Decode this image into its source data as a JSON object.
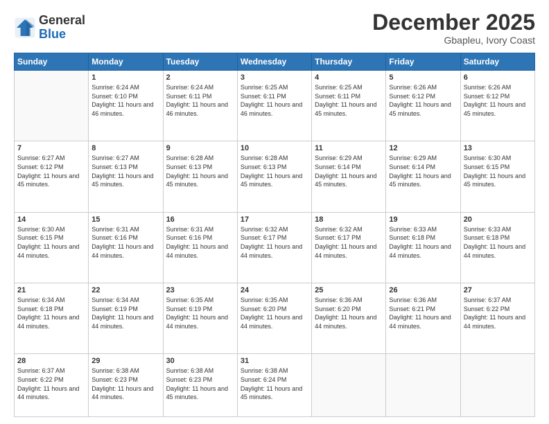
{
  "header": {
    "logo_line1": "General",
    "logo_line2": "Blue",
    "month": "December 2025",
    "location": "Gbapleu, Ivory Coast"
  },
  "weekdays": [
    "Sunday",
    "Monday",
    "Tuesday",
    "Wednesday",
    "Thursday",
    "Friday",
    "Saturday"
  ],
  "weeks": [
    [
      {
        "day": "",
        "empty": true
      },
      {
        "day": "1",
        "sunrise": "6:24 AM",
        "sunset": "6:10 PM",
        "daylight": "11 hours and 46 minutes."
      },
      {
        "day": "2",
        "sunrise": "6:24 AM",
        "sunset": "6:11 PM",
        "daylight": "11 hours and 46 minutes."
      },
      {
        "day": "3",
        "sunrise": "6:25 AM",
        "sunset": "6:11 PM",
        "daylight": "11 hours and 46 minutes."
      },
      {
        "day": "4",
        "sunrise": "6:25 AM",
        "sunset": "6:11 PM",
        "daylight": "11 hours and 45 minutes."
      },
      {
        "day": "5",
        "sunrise": "6:26 AM",
        "sunset": "6:12 PM",
        "daylight": "11 hours and 45 minutes."
      },
      {
        "day": "6",
        "sunrise": "6:26 AM",
        "sunset": "6:12 PM",
        "daylight": "11 hours and 45 minutes."
      }
    ],
    [
      {
        "day": "7",
        "sunrise": "6:27 AM",
        "sunset": "6:12 PM",
        "daylight": "11 hours and 45 minutes."
      },
      {
        "day": "8",
        "sunrise": "6:27 AM",
        "sunset": "6:13 PM",
        "daylight": "11 hours and 45 minutes."
      },
      {
        "day": "9",
        "sunrise": "6:28 AM",
        "sunset": "6:13 PM",
        "daylight": "11 hours and 45 minutes."
      },
      {
        "day": "10",
        "sunrise": "6:28 AM",
        "sunset": "6:13 PM",
        "daylight": "11 hours and 45 minutes."
      },
      {
        "day": "11",
        "sunrise": "6:29 AM",
        "sunset": "6:14 PM",
        "daylight": "11 hours and 45 minutes."
      },
      {
        "day": "12",
        "sunrise": "6:29 AM",
        "sunset": "6:14 PM",
        "daylight": "11 hours and 45 minutes."
      },
      {
        "day": "13",
        "sunrise": "6:30 AM",
        "sunset": "6:15 PM",
        "daylight": "11 hours and 45 minutes."
      }
    ],
    [
      {
        "day": "14",
        "sunrise": "6:30 AM",
        "sunset": "6:15 PM",
        "daylight": "11 hours and 44 minutes."
      },
      {
        "day": "15",
        "sunrise": "6:31 AM",
        "sunset": "6:16 PM",
        "daylight": "11 hours and 44 minutes."
      },
      {
        "day": "16",
        "sunrise": "6:31 AM",
        "sunset": "6:16 PM",
        "daylight": "11 hours and 44 minutes."
      },
      {
        "day": "17",
        "sunrise": "6:32 AM",
        "sunset": "6:17 PM",
        "daylight": "11 hours and 44 minutes."
      },
      {
        "day": "18",
        "sunrise": "6:32 AM",
        "sunset": "6:17 PM",
        "daylight": "11 hours and 44 minutes."
      },
      {
        "day": "19",
        "sunrise": "6:33 AM",
        "sunset": "6:18 PM",
        "daylight": "11 hours and 44 minutes."
      },
      {
        "day": "20",
        "sunrise": "6:33 AM",
        "sunset": "6:18 PM",
        "daylight": "11 hours and 44 minutes."
      }
    ],
    [
      {
        "day": "21",
        "sunrise": "6:34 AM",
        "sunset": "6:18 PM",
        "daylight": "11 hours and 44 minutes."
      },
      {
        "day": "22",
        "sunrise": "6:34 AM",
        "sunset": "6:19 PM",
        "daylight": "11 hours and 44 minutes."
      },
      {
        "day": "23",
        "sunrise": "6:35 AM",
        "sunset": "6:19 PM",
        "daylight": "11 hours and 44 minutes."
      },
      {
        "day": "24",
        "sunrise": "6:35 AM",
        "sunset": "6:20 PM",
        "daylight": "11 hours and 44 minutes."
      },
      {
        "day": "25",
        "sunrise": "6:36 AM",
        "sunset": "6:20 PM",
        "daylight": "11 hours and 44 minutes."
      },
      {
        "day": "26",
        "sunrise": "6:36 AM",
        "sunset": "6:21 PM",
        "daylight": "11 hours and 44 minutes."
      },
      {
        "day": "27",
        "sunrise": "6:37 AM",
        "sunset": "6:22 PM",
        "daylight": "11 hours and 44 minutes."
      }
    ],
    [
      {
        "day": "28",
        "sunrise": "6:37 AM",
        "sunset": "6:22 PM",
        "daylight": "11 hours and 44 minutes."
      },
      {
        "day": "29",
        "sunrise": "6:38 AM",
        "sunset": "6:23 PM",
        "daylight": "11 hours and 44 minutes."
      },
      {
        "day": "30",
        "sunrise": "6:38 AM",
        "sunset": "6:23 PM",
        "daylight": "11 hours and 45 minutes."
      },
      {
        "day": "31",
        "sunrise": "6:38 AM",
        "sunset": "6:24 PM",
        "daylight": "11 hours and 45 minutes."
      },
      {
        "day": "",
        "empty": true
      },
      {
        "day": "",
        "empty": true
      },
      {
        "day": "",
        "empty": true
      }
    ]
  ]
}
